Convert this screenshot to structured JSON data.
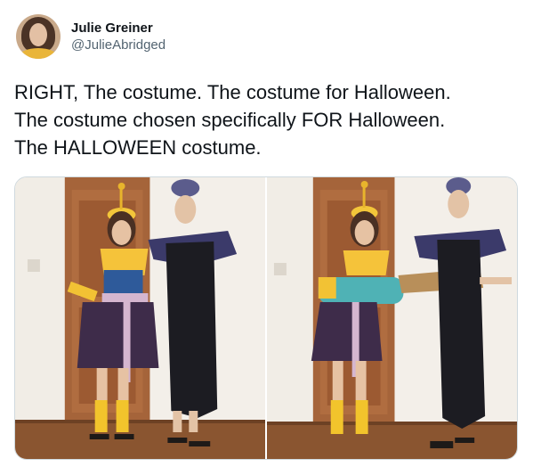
{
  "tweet": {
    "author": {
      "display_name": "Julie Greiner",
      "handle": "@JulieAbridged"
    },
    "text_lines": [
      "RIGHT, The costume. The costume for Halloween.",
      "The costume chosen specifically FOR Halloween.",
      "The HALLOWEEN costume."
    ],
    "media": [
      {
        "icon": "costume-photo-left"
      },
      {
        "icon": "costume-photo-right"
      }
    ]
  },
  "colors": {
    "text_primary": "#0f1419",
    "text_secondary": "#536471",
    "media_border": "#cfd9de"
  }
}
